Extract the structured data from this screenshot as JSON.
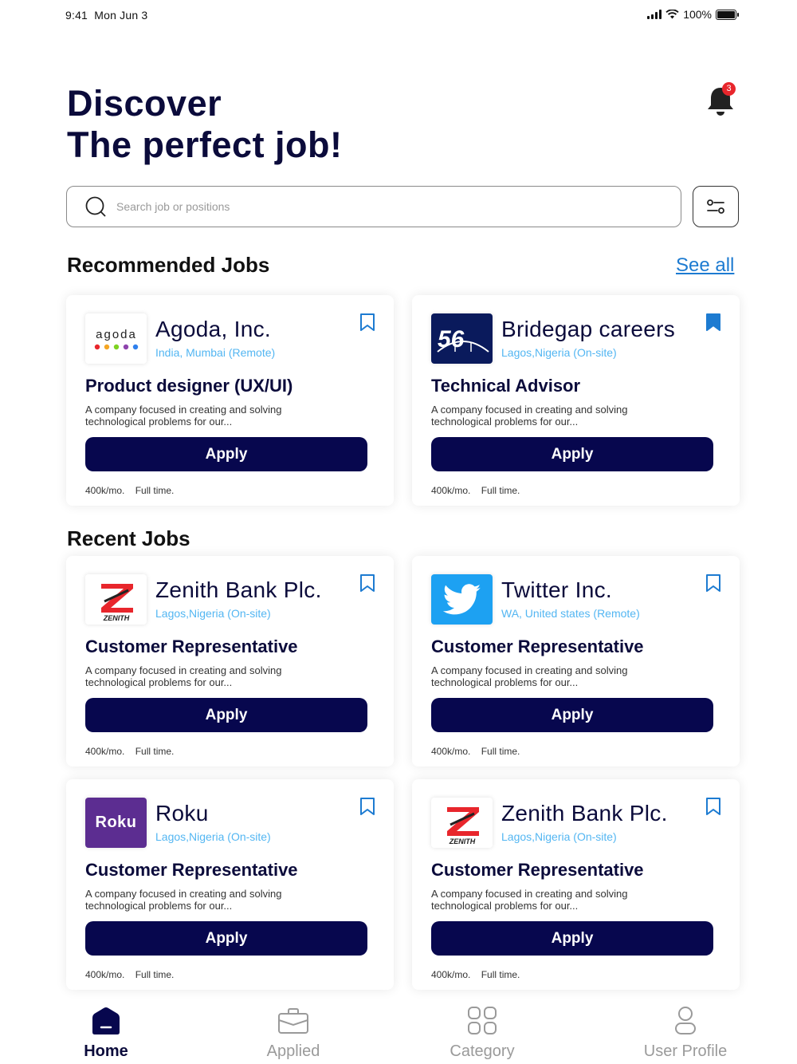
{
  "status": {
    "time": "9:41",
    "date": "Mon Jun 3",
    "battery": "100%"
  },
  "header": {
    "line1": "Discover",
    "line2": "The perfect job!",
    "notification_count": "3"
  },
  "search": {
    "placeholder": "Search job or positions"
  },
  "recommended": {
    "title": "Recommended Jobs",
    "see_all": "See all",
    "cards": [
      {
        "company": "Agoda, Inc.",
        "location": "India, Mumbai (Remote)",
        "job_title": "Product designer  (UX/UI)",
        "description": "A company focused in creating and solving technological problems for our...",
        "apply": "Apply",
        "salary": "400k/mo.",
        "type": "Full time.",
        "logo_text": "agoda",
        "bookmarked": false
      },
      {
        "company": "Bridegap careers",
        "location": "Lagos,Nigeria (On-site)",
        "job_title": "Technical Advisor",
        "description": "A company focused in creating and solving technological problems for our...",
        "apply": "Apply",
        "salary": "400k/mo.",
        "type": "Full time.",
        "logo_text": "56",
        "bookmarked": true
      }
    ]
  },
  "recent": {
    "title": "Recent Jobs",
    "cards": [
      {
        "company": "Zenith Bank Plc.",
        "location": "Lagos,Nigeria (On-site)",
        "job_title": "Customer Representative",
        "description": "A company focused in creating and solving technological problems for our...",
        "apply": "Apply",
        "salary": "400k/mo.",
        "type": "Full time.",
        "logo_text": "ZENITH"
      },
      {
        "company": "Twitter Inc.",
        "location": "WA, United states (Remote)",
        "job_title": "Customer Representative",
        "description": "A company focused in creating and solving technological problems for our...",
        "apply": "Apply",
        "salary": "400k/mo.",
        "type": "Full time."
      },
      {
        "company": "Roku",
        "location": "Lagos,Nigeria (On-site)",
        "job_title": "Customer Representative",
        "description": "A company focused in creating and solving technological problems for our...",
        "apply": "Apply",
        "salary": "400k/mo.",
        "type": "Full time.",
        "logo_text": "Roku"
      },
      {
        "company": "Zenith Bank Plc.",
        "location": "Lagos,Nigeria (On-site)",
        "job_title": "Customer Representative",
        "description": "A company focused in creating and solving technological problems for our...",
        "apply": "Apply",
        "salary": "400k/mo.",
        "type": "Full time.",
        "logo_text": "ZENITH"
      }
    ]
  },
  "tabs": [
    {
      "label": "Home",
      "icon": "home-icon",
      "active": true
    },
    {
      "label": "Applied",
      "icon": "briefcase-icon",
      "active": false
    },
    {
      "label": "Category",
      "icon": "category-icon",
      "active": false
    },
    {
      "label": "User Profile",
      "icon": "user-icon",
      "active": false
    }
  ],
  "colors": {
    "primary": "#07074e",
    "link": "#1d7bd1",
    "location": "#53b6f2",
    "badge": "#e8262c"
  }
}
